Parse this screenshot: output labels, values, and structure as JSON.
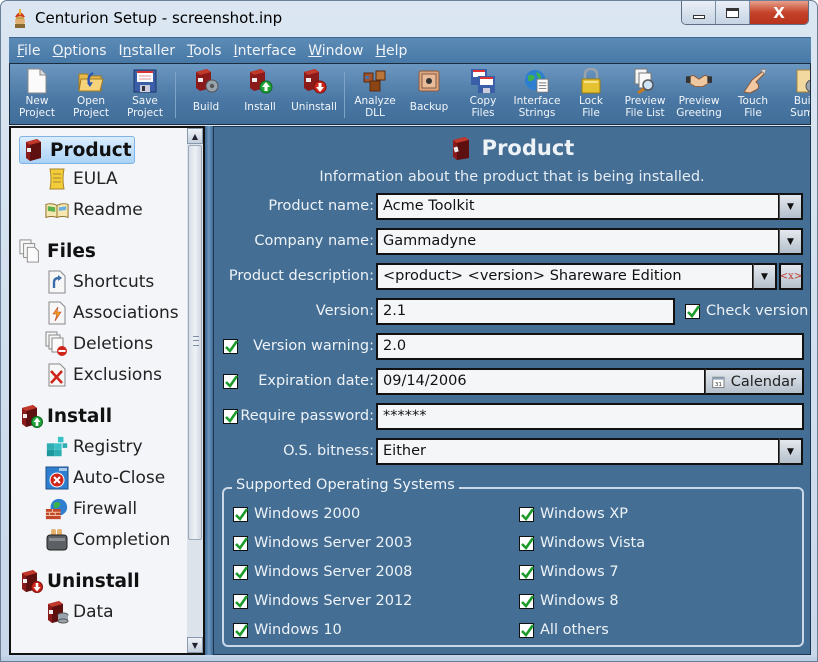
{
  "window": {
    "title": "Centurion Setup - screenshot.inp",
    "app_icon": "centurion-helmet-icon",
    "controls": {
      "minimize": "minimize",
      "maximize": "maximize",
      "close": "X"
    }
  },
  "menubar": {
    "items": [
      {
        "label": "File",
        "accel": "F",
        "rest": "ile"
      },
      {
        "label": "Options",
        "accel": "O",
        "rest": "ptions"
      },
      {
        "label": "Installer",
        "accel": "I",
        "pre": "I",
        "accel2": "n",
        "rest": "staller"
      },
      {
        "label": "Tools",
        "accel": "T",
        "rest": "ools"
      },
      {
        "label": "Interface",
        "accel": "I",
        "rest": "nterface"
      },
      {
        "label": "Window",
        "accel": "W",
        "rest": "indow"
      },
      {
        "label": "Help",
        "accel": "H",
        "rest": "elp"
      }
    ]
  },
  "toolbar": {
    "items": [
      {
        "line1": "New",
        "line2": "Project",
        "icon": "new-document-icon"
      },
      {
        "line1": "Open",
        "line2": "Project",
        "icon": "open-folder-icon"
      },
      {
        "line1": "Save",
        "line2": "Project",
        "icon": "floppy-disk-icon"
      },
      {
        "line1": "Build",
        "line2": "",
        "icon": "build-gear-icon"
      },
      {
        "line1": "Install",
        "line2": "",
        "icon": "install-arrow-up-icon"
      },
      {
        "line1": "Uninstall",
        "line2": "",
        "icon": "uninstall-arrow-down-icon"
      },
      {
        "line1": "Analyze",
        "line2": "DLL",
        "icon": "analyze-dll-icon"
      },
      {
        "line1": "Backup",
        "line2": "",
        "icon": "safe-icon"
      },
      {
        "line1": "Copy",
        "line2": "Files",
        "icon": "copy-files-icon"
      },
      {
        "line1": "Interface",
        "line2": "Strings",
        "icon": "globe-document-icon"
      },
      {
        "line1": "Lock",
        "line2": "File",
        "icon": "padlock-icon"
      },
      {
        "line1": "Preview",
        "line2": "File List",
        "icon": "magnifier-files-icon"
      },
      {
        "line1": "Preview",
        "line2": "Greeting",
        "icon": "handshake-icon"
      },
      {
        "line1": "Touch",
        "line2": "File",
        "icon": "pointing-hand-icon"
      },
      {
        "line1": "Build",
        "line2": "Summ",
        "icon": "scroll-gear-icon"
      }
    ]
  },
  "sidebar": {
    "groups": [
      {
        "label": "Product",
        "icon": "product-box-icon",
        "selected": true,
        "children": [
          {
            "label": "EULA",
            "icon": "scroll-icon"
          },
          {
            "label": "Readme",
            "icon": "open-book-icon"
          }
        ]
      },
      {
        "label": "Files",
        "icon": "files-stack-icon",
        "selected": false,
        "children": [
          {
            "label": "Shortcuts",
            "icon": "shortcut-file-icon"
          },
          {
            "label": "Associations",
            "icon": "association-file-icon"
          },
          {
            "label": "Deletions",
            "icon": "deletion-files-icon"
          },
          {
            "label": "Exclusions",
            "icon": "exclusion-file-icon"
          }
        ]
      },
      {
        "label": "Install",
        "icon": "install-box-icon",
        "selected": false,
        "children": [
          {
            "label": "Registry",
            "icon": "registry-cubes-icon"
          },
          {
            "label": "Auto-Close",
            "icon": "auto-close-window-icon"
          },
          {
            "label": "Firewall",
            "icon": "firewall-globe-icon"
          },
          {
            "label": "Completion",
            "icon": "toaster-icon"
          }
        ]
      },
      {
        "label": "Uninstall",
        "icon": "uninstall-box-icon",
        "selected": false,
        "children": [
          {
            "label": "Data",
            "icon": "data-box-icon"
          }
        ]
      }
    ]
  },
  "main": {
    "title": "Product",
    "subtitle": "Information about the product that is being installed.",
    "fields": {
      "product_name": {
        "label": "Product name:",
        "value": "Acme Toolkit"
      },
      "company_name": {
        "label": "Company name:",
        "value": "Gammadyne"
      },
      "product_description": {
        "label": "Product description:",
        "value": "<product> <version> Shareware Edition",
        "variable_button": "<x>"
      },
      "version": {
        "label": "Version:",
        "value": "2.1",
        "check_label": "Check version",
        "check_checked": true
      },
      "version_warning": {
        "label": "Version warning:",
        "value": "2.0",
        "enabled": true
      },
      "expiration_date": {
        "label": "Expiration date:",
        "value": "09/14/2006",
        "enabled": true,
        "calendar_label": "Calendar"
      },
      "require_password": {
        "label": "Require password:",
        "value": "******",
        "enabled": true
      },
      "os_bitness": {
        "label": "O.S. bitness:",
        "value": "Either"
      }
    },
    "supported_os": {
      "legend": "Supported Operating Systems",
      "left": [
        {
          "label": "Windows 2000",
          "checked": true
        },
        {
          "label": "Windows Server 2003",
          "checked": true
        },
        {
          "label": "Windows Server 2008",
          "checked": true
        },
        {
          "label": "Windows Server 2012",
          "checked": true
        },
        {
          "label": "Windows 10",
          "checked": true
        }
      ],
      "right": [
        {
          "label": "Windows XP",
          "checked": true
        },
        {
          "label": "Windows Vista",
          "checked": true
        },
        {
          "label": "Windows 7",
          "checked": true
        },
        {
          "label": "Windows 8",
          "checked": true
        },
        {
          "label": "All others",
          "checked": true
        }
      ]
    }
  },
  "colors": {
    "panel_bg": "#446e94",
    "menubar_bg": "#4f7fac",
    "checkmark": "#1c9a2a",
    "selection_bg": "#a9d2f6",
    "close_button": "#c5432a"
  }
}
